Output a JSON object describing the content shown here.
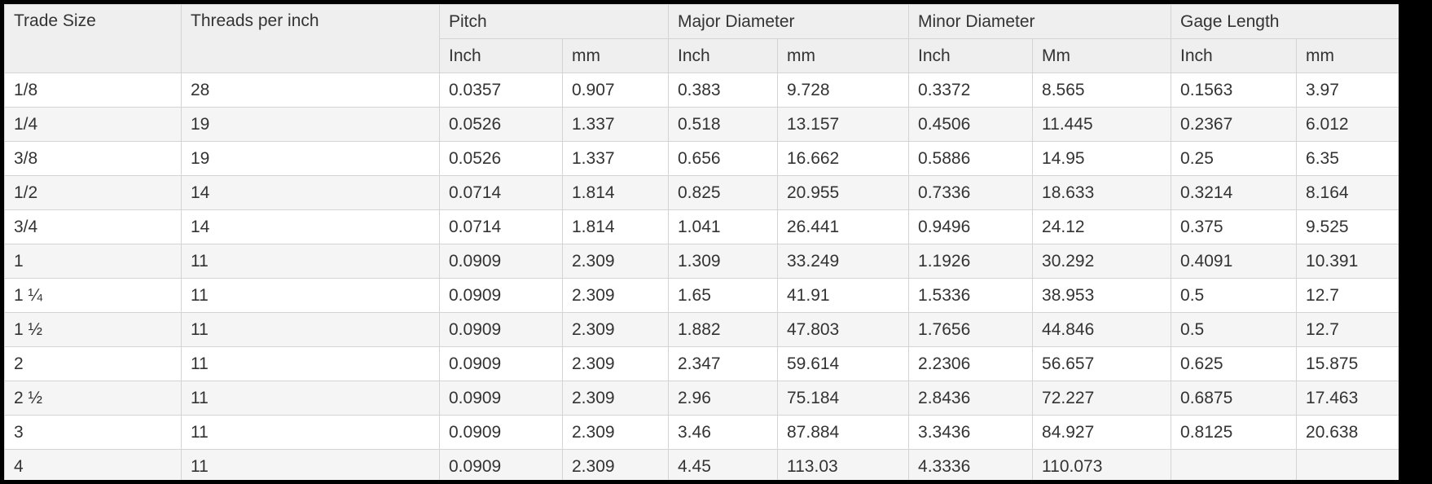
{
  "table": {
    "headers": {
      "trade_size": "Trade Size",
      "threads_per_inch": "Threads per inch",
      "pitch": "Pitch",
      "major_diameter": "Major Diameter",
      "minor_diameter": "Minor Diameter",
      "gage_length": "Gage Length"
    },
    "subheaders": [
      "Inch",
      "mm",
      "Inch",
      "mm",
      "Inch",
      "Mm",
      "Inch",
      "mm"
    ],
    "rows": [
      [
        "1/8",
        "28",
        "0.0357",
        "0.907",
        "0.383",
        "9.728",
        "0.3372",
        "8.565",
        "0.1563",
        "3.97"
      ],
      [
        "1/4",
        "19",
        "0.0526",
        "1.337",
        "0.518",
        "13.157",
        "0.4506",
        "11.445",
        "0.2367",
        "6.012"
      ],
      [
        "3/8",
        "19",
        "0.0526",
        "1.337",
        "0.656",
        "16.662",
        "0.5886",
        "14.95",
        "0.25",
        "6.35"
      ],
      [
        "1/2",
        "14",
        "0.0714",
        "1.814",
        "0.825",
        "20.955",
        "0.7336",
        "18.633",
        "0.3214",
        "8.164"
      ],
      [
        "3/4",
        "14",
        "0.0714",
        "1.814",
        "1.041",
        "26.441",
        "0.9496",
        "24.12",
        "0.375",
        "9.525"
      ],
      [
        "1",
        "11",
        "0.0909",
        "2.309",
        "1.309",
        "33.249",
        "1.1926",
        "30.292",
        "0.4091",
        "10.391"
      ],
      [
        "1 ¼",
        "11",
        "0.0909",
        "2.309",
        "1.65",
        "41.91",
        "1.5336",
        "38.953",
        "0.5",
        "12.7"
      ],
      [
        "1 ½",
        "11",
        "0.0909",
        "2.309",
        "1.882",
        "47.803",
        "1.7656",
        "44.846",
        "0.5",
        "12.7"
      ],
      [
        "2",
        "11",
        "0.0909",
        "2.309",
        "2.347",
        "59.614",
        "2.2306",
        "56.657",
        "0.625",
        "15.875"
      ],
      [
        "2 ½",
        "11",
        "0.0909",
        "2.309",
        "2.96",
        "75.184",
        "2.8436",
        "72.227",
        "0.6875",
        "17.463"
      ],
      [
        "3",
        "11",
        "0.0909",
        "2.309",
        "3.46",
        "87.884",
        "3.3436",
        "84.927",
        "0.8125",
        "20.638"
      ],
      [
        "4",
        "11",
        "0.0909",
        "2.309",
        "4.45",
        "113.03",
        "4.3336",
        "110.073",
        "",
        ""
      ]
    ]
  }
}
